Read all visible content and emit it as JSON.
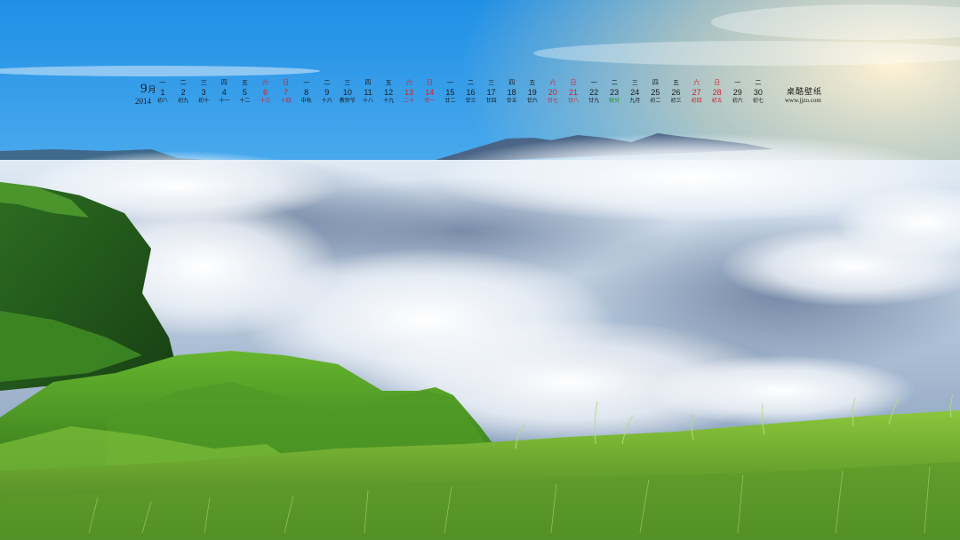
{
  "calendar": {
    "month": "9",
    "month_unit": "月",
    "year": "2014",
    "brand": "桌酷壁纸",
    "site": "www.jjzo.com",
    "colors": {
      "weekday": "#1a1a1a",
      "weekend": "#d4202a",
      "festival": "#1f8a2a"
    },
    "days": [
      {
        "weekday": "一",
        "date": "1",
        "lunar": "初八",
        "kind": "weekday"
      },
      {
        "weekday": "二",
        "date": "2",
        "lunar": "初九",
        "kind": "weekday"
      },
      {
        "weekday": "三",
        "date": "3",
        "lunar": "初十",
        "kind": "weekday"
      },
      {
        "weekday": "四",
        "date": "4",
        "lunar": "十一",
        "kind": "weekday"
      },
      {
        "weekday": "五",
        "date": "5",
        "lunar": "十二",
        "kind": "weekday"
      },
      {
        "weekday": "六",
        "date": "6",
        "lunar": "十三",
        "kind": "weekend"
      },
      {
        "weekday": "日",
        "date": "7",
        "lunar": "十四",
        "kind": "weekend"
      },
      {
        "weekday": "一",
        "date": "8",
        "lunar": "中秋",
        "kind": "weekday"
      },
      {
        "weekday": "二",
        "date": "9",
        "lunar": "十六",
        "kind": "weekday"
      },
      {
        "weekday": "三",
        "date": "10",
        "lunar": "教师节",
        "kind": "weekday"
      },
      {
        "weekday": "四",
        "date": "11",
        "lunar": "十八",
        "kind": "weekday"
      },
      {
        "weekday": "五",
        "date": "12",
        "lunar": "十九",
        "kind": "weekday"
      },
      {
        "weekday": "六",
        "date": "13",
        "lunar": "二十",
        "kind": "weekend"
      },
      {
        "weekday": "日",
        "date": "14",
        "lunar": "廿一",
        "kind": "weekend"
      },
      {
        "weekday": "一",
        "date": "15",
        "lunar": "廿二",
        "kind": "weekday"
      },
      {
        "weekday": "二",
        "date": "16",
        "lunar": "廿三",
        "kind": "weekday"
      },
      {
        "weekday": "三",
        "date": "17",
        "lunar": "廿四",
        "kind": "weekday"
      },
      {
        "weekday": "四",
        "date": "18",
        "lunar": "廿五",
        "kind": "weekday"
      },
      {
        "weekday": "五",
        "date": "19",
        "lunar": "廿六",
        "kind": "weekday"
      },
      {
        "weekday": "六",
        "date": "20",
        "lunar": "廿七",
        "kind": "weekend"
      },
      {
        "weekday": "日",
        "date": "21",
        "lunar": "廿八",
        "kind": "weekend"
      },
      {
        "weekday": "一",
        "date": "22",
        "lunar": "廿九",
        "kind": "weekday"
      },
      {
        "weekday": "二",
        "date": "23",
        "lunar": "秋分",
        "kind": "festival"
      },
      {
        "weekday": "三",
        "date": "24",
        "lunar": "九月",
        "kind": "weekday"
      },
      {
        "weekday": "四",
        "date": "25",
        "lunar": "初二",
        "kind": "weekday"
      },
      {
        "weekday": "五",
        "date": "26",
        "lunar": "初三",
        "kind": "weekday"
      },
      {
        "weekday": "六",
        "date": "27",
        "lunar": "初四",
        "kind": "weekend"
      },
      {
        "weekday": "日",
        "date": "28",
        "lunar": "初五",
        "kind": "weekend"
      },
      {
        "weekday": "一",
        "date": "29",
        "lunar": "初六",
        "kind": "weekday"
      },
      {
        "weekday": "二",
        "date": "30",
        "lunar": "初七",
        "kind": "weekday"
      }
    ]
  }
}
